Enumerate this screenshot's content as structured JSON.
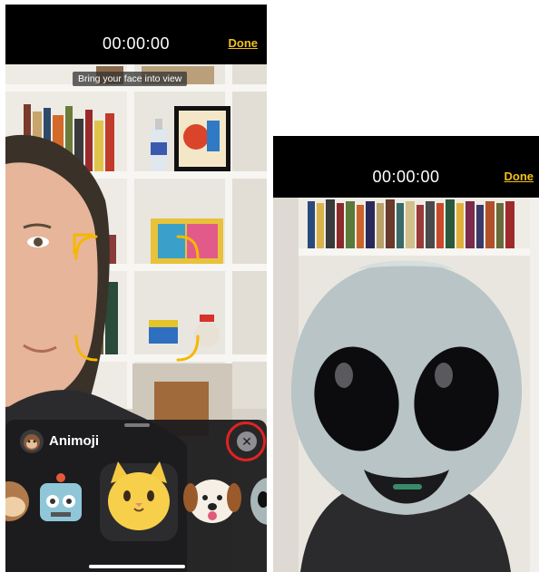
{
  "left_screen": {
    "timer": "00:00:00",
    "done_label": "Done",
    "face_hint": "Bring your face into view",
    "sheet": {
      "title": "Animoji",
      "title_icon": "monkey-icon",
      "close_icon": "close-icon",
      "characters": [
        "monkey",
        "robot",
        "cat",
        "dog",
        "alien"
      ],
      "selected": "cat"
    },
    "colors": {
      "accent": "#f3c01c",
      "face_frame": "#f5b800",
      "highlight": "#e02323"
    }
  },
  "right_screen": {
    "timer": "00:00:00",
    "done_label": "Done",
    "active_character": "alien"
  }
}
